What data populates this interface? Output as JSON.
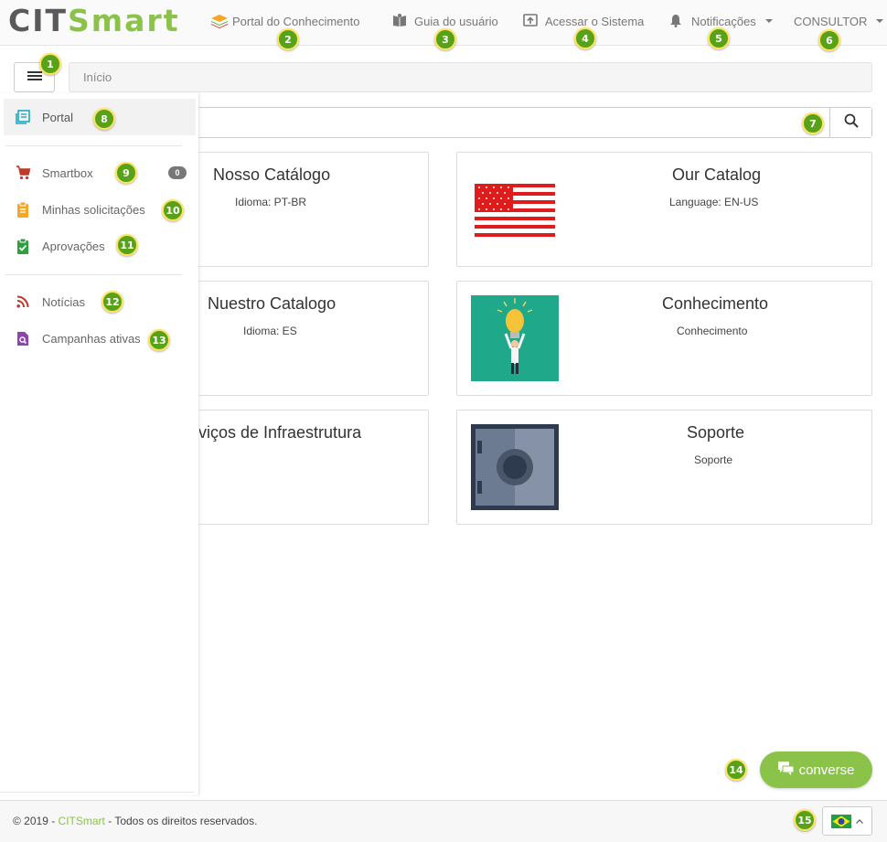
{
  "brand": {
    "part1": "CIT",
    "part2": "Smart"
  },
  "nav": {
    "portal": "Portal do Conhecimento",
    "guide": "Guia do usuário",
    "access": "Acessar o Sistema",
    "notifications": "Notificações",
    "user": "CONSULTOR"
  },
  "breadcrumb": "Início",
  "search": {
    "placeholder": ""
  },
  "sidebar": {
    "items": [
      {
        "label": "Portal",
        "icon": "portal-icon"
      },
      {
        "label": "Smartbox",
        "icon": "cart-icon",
        "count": "0"
      },
      {
        "label": "Minhas solicitações",
        "icon": "clipboard-icon"
      },
      {
        "label": "Aprovações",
        "icon": "approval-icon"
      },
      {
        "label": "Notícias",
        "icon": "rss-icon"
      },
      {
        "label": "Campanhas ativas",
        "icon": "campaign-icon"
      }
    ]
  },
  "catalogs": [
    {
      "title": "Nosso Catálogo",
      "subtitle": "Idioma: PT-BR"
    },
    {
      "title": "Our Catalog",
      "subtitle": "Language: EN-US"
    },
    {
      "title": "Nuestro Catalogo",
      "subtitle": "Idioma: ES"
    },
    {
      "title": "Conhecimento",
      "subtitle": "Conhecimento"
    },
    {
      "title": "rviços de Infraestrutura",
      "subtitle": ""
    },
    {
      "title": "Soporte",
      "subtitle": "Soporte"
    }
  ],
  "converse": "converse",
  "footer": {
    "prefix": "© 2019 - ",
    "brand": "CITSmart",
    "suffix": " - Todos os direitos reservados."
  },
  "callouts": [
    "1",
    "2",
    "3",
    "4",
    "5",
    "6",
    "7",
    "8",
    "9",
    "10",
    "11",
    "12",
    "13",
    "14",
    "15"
  ],
  "colors": {
    "accent": "#8bc34a",
    "callout": "#58a21a"
  }
}
